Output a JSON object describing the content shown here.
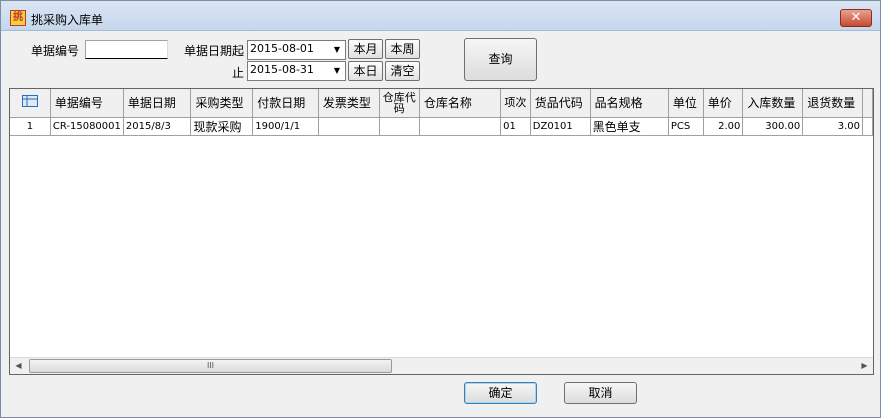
{
  "window": {
    "title": "挑采购入库单",
    "close_label": "✕"
  },
  "filters": {
    "doc_no_label": "单据编号",
    "doc_no_value": "",
    "date_from_label": "单据日期起",
    "date_from_value": "2015-08-01",
    "date_to_label": "止",
    "date_to_value": "2015-08-31",
    "btn_this_month": "本月",
    "btn_this_week": "本周",
    "btn_today": "本日",
    "btn_clear": "清空",
    "btn_query": "查询"
  },
  "grid": {
    "columns": [
      "",
      "单据编号",
      "单据日期",
      "采购类型",
      "付款日期",
      "发票类型",
      "仓库代码",
      "仓库名称",
      "项次",
      "货品代码",
      "品名规格",
      "单位",
      "单价",
      "入库数量",
      "退货数量",
      ""
    ],
    "rows": [
      [
        "1",
        "CR-15080001",
        "2015/8/3",
        "现款采购",
        "1900/1/1",
        "",
        "",
        "",
        "01",
        "DZ0101",
        "黑色单支",
        "PCS",
        "2.00",
        "300.00",
        "3.00",
        ""
      ]
    ],
    "scroll_thumb_mark": "III"
  },
  "footer": {
    "ok_label": "确定",
    "cancel_label": "取消"
  },
  "icons": {
    "app": "app-logo-icon",
    "grid_corner": "table-icon"
  }
}
